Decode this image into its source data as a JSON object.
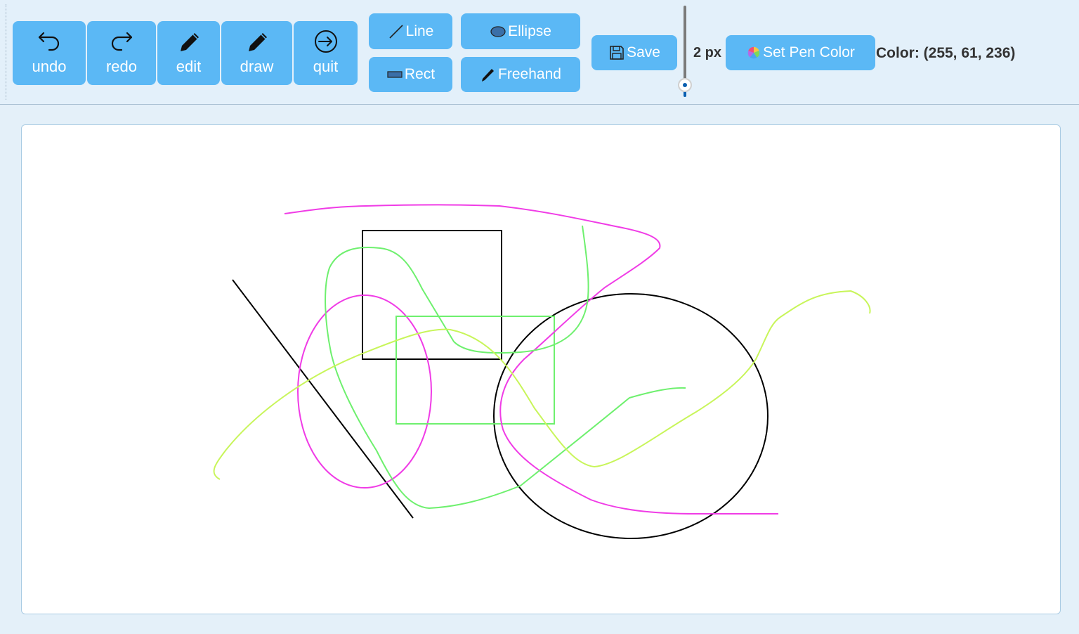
{
  "toolbar": {
    "undo_label": "undo",
    "redo_label": "redo",
    "edit_label": "edit",
    "draw_label": "draw",
    "quit_label": "quit",
    "line_label": "Line",
    "ellipse_label": "Ellipse",
    "rect_label": "Rect",
    "freehand_label": "Freehand",
    "save_label": "Save",
    "pen_width_label": "2 px",
    "pen_width_value": 2,
    "set_pen_color_label": "Set Pen Color",
    "color_readout": "Color: (255, 61, 236)"
  },
  "colors": {
    "button": "#5bb8f5",
    "toolbar_bg": "#e3f0fa",
    "canvas_bg": "#ffffff",
    "pen_color": "#ff3dec",
    "stroke_black": "#000000",
    "stroke_magenta": "#f03ce6",
    "stroke_green": "#6ef06e",
    "stroke_lime": "#c8f55a"
  },
  "icons": {
    "undo": "undo-arrow-icon",
    "redo": "redo-arrow-icon",
    "edit": "pencil-icon",
    "draw": "pencil-icon",
    "quit": "exit-circle-icon",
    "line": "diagonal-line-icon",
    "ellipse": "ellipse-icon",
    "rect": "rectangle-icon",
    "freehand": "pen-icon",
    "save": "floppy-disk-icon",
    "color": "color-wheel-icon"
  }
}
